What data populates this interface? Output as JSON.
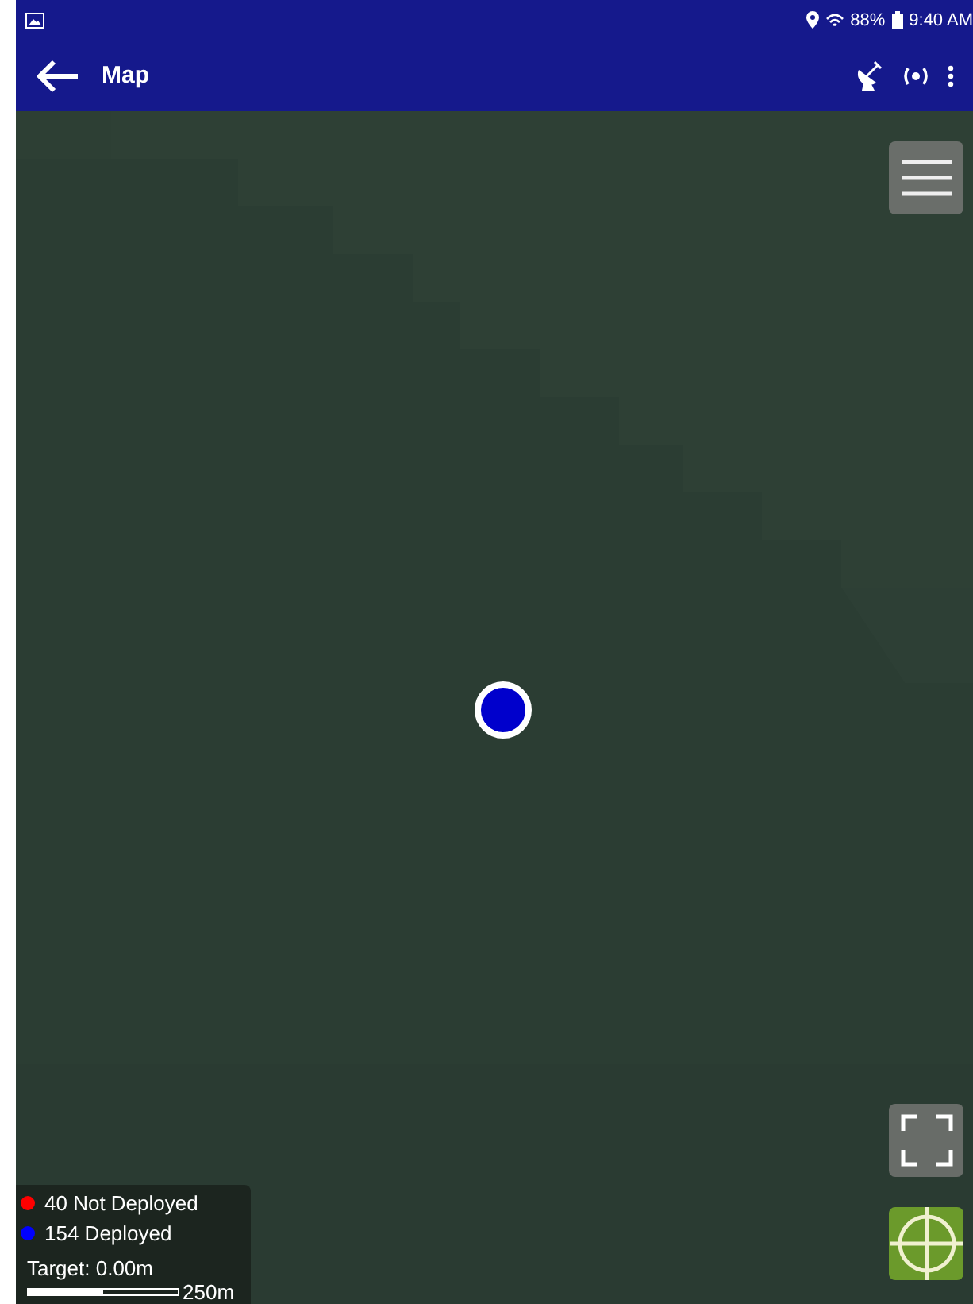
{
  "status_bar": {
    "battery": "88%",
    "time": "9:40 AM"
  },
  "app_bar": {
    "title": "Map"
  },
  "legend": {
    "items": [
      {
        "label": "40 Not Deployed",
        "color": "#ff0000"
      },
      {
        "label": "154 Deployed",
        "color": "#0000ff"
      }
    ],
    "target": "Target: 0.00m",
    "scale": {
      "level": 0.5,
      "label": "250m"
    }
  }
}
